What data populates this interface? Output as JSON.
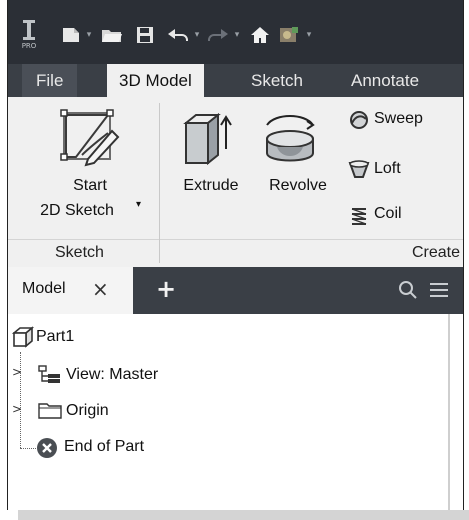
{
  "colors": {
    "titlebar": "#2b2f36",
    "tabbar": "#3a3f46",
    "ribbon": "#f0f0f0",
    "accent": "#3d86c6"
  },
  "qat": {
    "app_badge": "PRO",
    "icons": [
      "app-logo-icon",
      "new-file-icon",
      "open-folder-icon",
      "save-icon",
      "undo-icon",
      "redo-icon",
      "home-icon",
      "appearance-icon"
    ]
  },
  "tabs": [
    {
      "label": "File"
    },
    {
      "label": "3D Model"
    },
    {
      "label": "Sketch"
    },
    {
      "label": "Annotate"
    }
  ],
  "ribbon": {
    "sketch_panel": {
      "title": "Sketch",
      "button_line1": "Start",
      "button_line2": "2D Sketch"
    },
    "create_panel": {
      "title": "Create",
      "extrude": "Extrude",
      "revolve": "Revolve",
      "sweep": "Sweep",
      "loft": "Loft",
      "coil": "Coil"
    }
  },
  "browser": {
    "tab_label": "Model",
    "close": "×",
    "add": "+",
    "tree": {
      "root": "Part1",
      "view": "View: Master",
      "origin": "Origin",
      "end": "End of Part"
    }
  }
}
